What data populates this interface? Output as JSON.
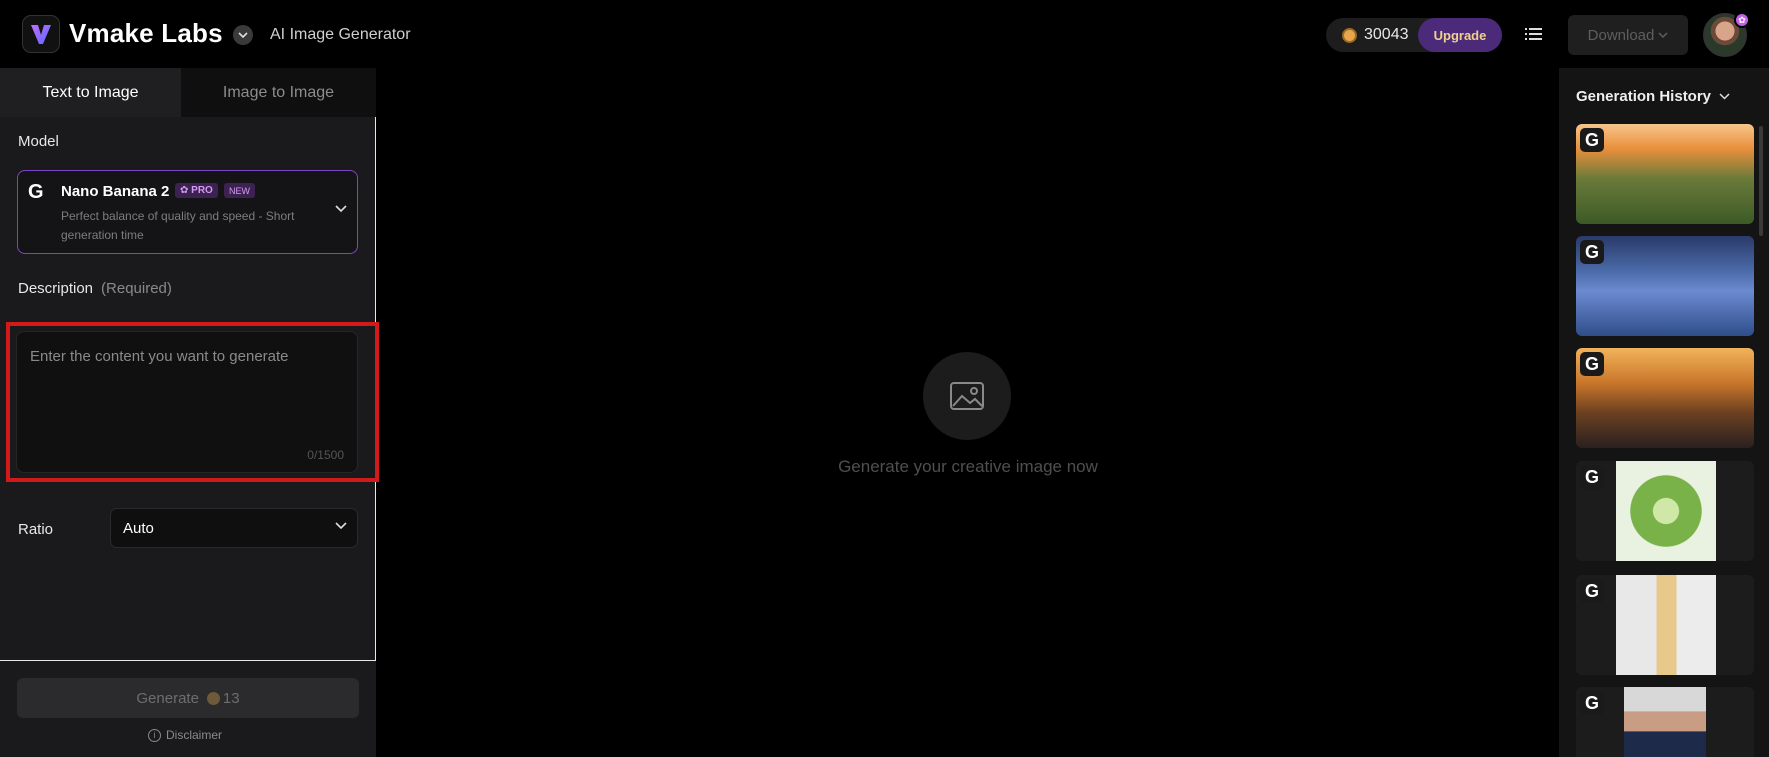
{
  "header": {
    "brand": "Vmake Labs",
    "subtitle": "AI Image Generator",
    "credits": "30043",
    "upgrade_label": "Upgrade",
    "download_label": "Download"
  },
  "tabs": [
    {
      "label": "Text to Image",
      "active": true
    },
    {
      "label": "Image to Image",
      "active": false
    }
  ],
  "model": {
    "section_label": "Model",
    "name": "Nano Banana 2",
    "pro_badge": "✿ PRO",
    "new_badge": "NEW",
    "description": "Perfect balance of quality and speed - Short generation time"
  },
  "description": {
    "label": "Description",
    "required": "(Required)",
    "placeholder": "Enter the content you want to generate",
    "value": "",
    "counter": "0/1500"
  },
  "ratio": {
    "label": "Ratio",
    "value": "Auto"
  },
  "generate": {
    "label": "Generate",
    "cost": "13"
  },
  "disclaimer": "Disclaimer",
  "center": {
    "empty_text": "Generate your creative image now"
  },
  "history": {
    "title": "Generation History",
    "items": [
      {
        "badge": "G"
      },
      {
        "badge": "G"
      },
      {
        "badge": "G"
      },
      {
        "badge": "G"
      },
      {
        "badge": "G"
      },
      {
        "badge": "G"
      }
    ]
  },
  "colors": {
    "accent": "#7b46c7",
    "upgrade_bg": "#4b2a7a",
    "highlight": "#d21a1a"
  }
}
